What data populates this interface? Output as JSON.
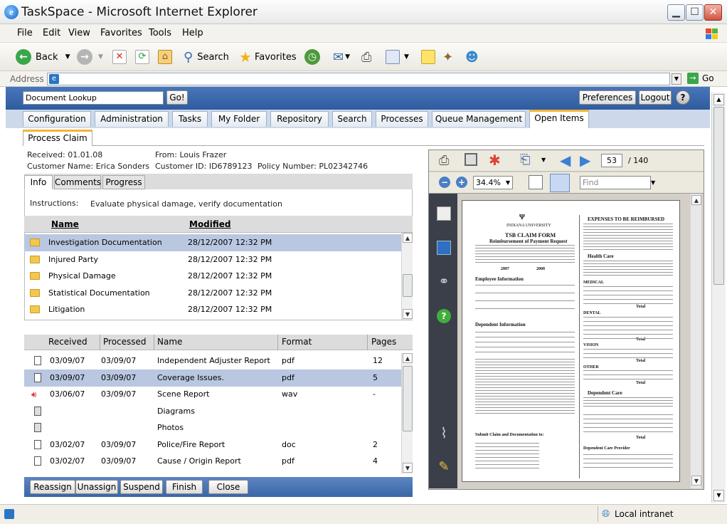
{
  "window": {
    "title": "TaskSpace - Microsoft Internet Explorer"
  },
  "menu": [
    "File",
    "Edit",
    "View",
    "Favorites",
    "Tools",
    "Help"
  ],
  "toolbar": {
    "back": "Back",
    "search": "Search",
    "favorites": "Favorites"
  },
  "address": {
    "label": "Address",
    "go": "Go"
  },
  "app": {
    "lookup_value": "Document Lookup",
    "go_button": "Go!",
    "preferences": "Preferences",
    "logout": "Logout",
    "help": "?",
    "tabs": [
      "Configuration",
      "Administration",
      "Tasks",
      "My Folder",
      "Repository",
      "Search",
      "Processes",
      "Queue Management",
      "Open Items"
    ],
    "subtab": "Process Claim"
  },
  "claim": {
    "received": "Received: 01.01.08",
    "from": "From: Louis Frazer",
    "customer_name": "Customer Name: Erica Sonders",
    "customer_id": "Customer ID: ID6789123",
    "policy_number": "Policy Number: PL02342746"
  },
  "panel_tabs": [
    "Info",
    "Comments",
    "Progress"
  ],
  "instructions": {
    "label": "Instructions:",
    "text": "Evaluate physical damage, verify documentation"
  },
  "folders": {
    "headers": [
      "Name",
      "Modified"
    ],
    "rows": [
      {
        "name": "Investigation Documentation",
        "modified": "28/12/2007 12:32 PM"
      },
      {
        "name": "Injured Party",
        "modified": "28/12/2007 12:32 PM"
      },
      {
        "name": "Physical Damage",
        "modified": "28/12/2007 12:32 PM"
      },
      {
        "name": "Statistical Documentation",
        "modified": "28/12/2007 12:32 PM"
      },
      {
        "name": "Litigation",
        "modified": "28/12/2007 12:32 PM"
      }
    ]
  },
  "documents": {
    "headers": [
      "Received",
      "Processed",
      "Name",
      "Format",
      "Pages"
    ],
    "rows": [
      {
        "received": "03/09/07",
        "processed": "03/09/07",
        "name": "Independent Adjuster Report",
        "format": "pdf",
        "pages": "12"
      },
      {
        "received": "03/09/07",
        "processed": "03/09/07",
        "name": "Coverage Issues.",
        "format": "pdf",
        "pages": "5"
      },
      {
        "received": "03/06/07",
        "processed": "03/09/07",
        "name": "Scene Report",
        "format": "wav",
        "pages": "-"
      },
      {
        "received": "",
        "processed": "",
        "name": "Diagrams",
        "format": "",
        "pages": ""
      },
      {
        "received": "",
        "processed": "",
        "name": "Photos",
        "format": "",
        "pages": ""
      },
      {
        "received": "03/02/07",
        "processed": "03/09/07",
        "name": "Police/Fire Report",
        "format": "doc",
        "pages": "2"
      },
      {
        "received": "03/02/07",
        "processed": "03/09/07",
        "name": "Cause / Origin Report",
        "format": "pdf",
        "pages": "4"
      }
    ]
  },
  "actions": [
    "Reassign",
    "Unassign",
    "Suspend",
    "Finish",
    "Close"
  ],
  "viewer": {
    "page": "53",
    "total": "/ 140",
    "zoom": "34.4%",
    "find_placeholder": "Find",
    "doc": {
      "university": "INDIANA UNIVERSITY",
      "form_title": "TSB CLAIM FORM",
      "form_subtitle": "Reimbursement of Payment Request",
      "y2007": "2007",
      "y2008": "2008",
      "employee_info": "Employee Information",
      "dependent_info": "Dependent Information",
      "submit": "Submit Claim and Documentation to:",
      "expenses_title": "EXPENSES TO BE REIMBURSED",
      "health_care": "Health Care",
      "dependent_care": "Dependent Care",
      "medical": "MEDICAL",
      "dental": "DENTAL",
      "vision": "VISION",
      "other": "OTHER",
      "total": "Total",
      "provider": "Dependent Care Provider"
    }
  },
  "status": {
    "zone": "Local intranet"
  }
}
